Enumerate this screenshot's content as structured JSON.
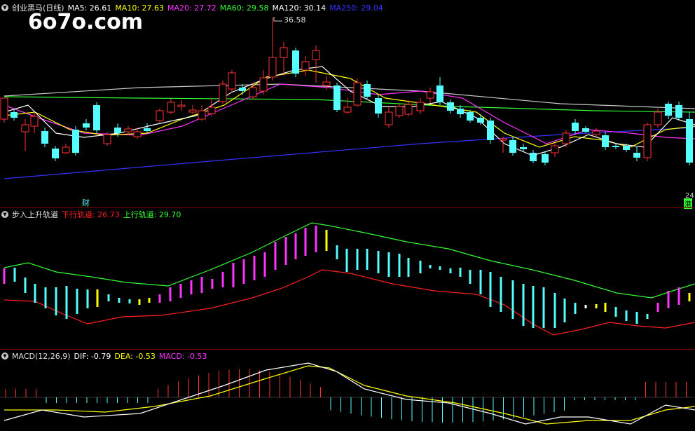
{
  "watermark": "6o7o.com",
  "main": {
    "stock_name": "创业黑马(日线)",
    "ma": [
      {
        "label": "MA5: 26.61",
        "color": "#ffffff"
      },
      {
        "label": "MA10: 27.63",
        "color": "#ffff00"
      },
      {
        "label": "MA20: 27.72",
        "color": "#ff33ff"
      },
      {
        "label": "MA60: 29.58",
        "color": "#33ff33"
      },
      {
        "label": "MA120: 30.14",
        "color": "#ffffff"
      },
      {
        "label": "MA250: 29.04",
        "color": "#3333ff"
      }
    ],
    "high_label": "36.58",
    "marker_cai": "财",
    "marker_num": "24",
    "marker_gang": "港"
  },
  "indicator": {
    "name": "步入上升轨道",
    "lower_label": "下行轨道: 26.73",
    "upper_label": "上行轨道: 29.70",
    "lower_color": "#ff2020",
    "upper_color": "#33ff33"
  },
  "macd": {
    "name": "MACD(12,26,9)",
    "dif_label": "DIF: -0.79",
    "dea_label": "DEA: -0.53",
    "macd_label": "MACD: -0.53",
    "dif_color": "#ffffff",
    "dea_color": "#ffff00",
    "macd_color": "#ff33ff"
  },
  "colors": {
    "up": "#ff3333",
    "down": "#55ffff",
    "bg": "#000000",
    "divider": "#7a0000"
  }
}
